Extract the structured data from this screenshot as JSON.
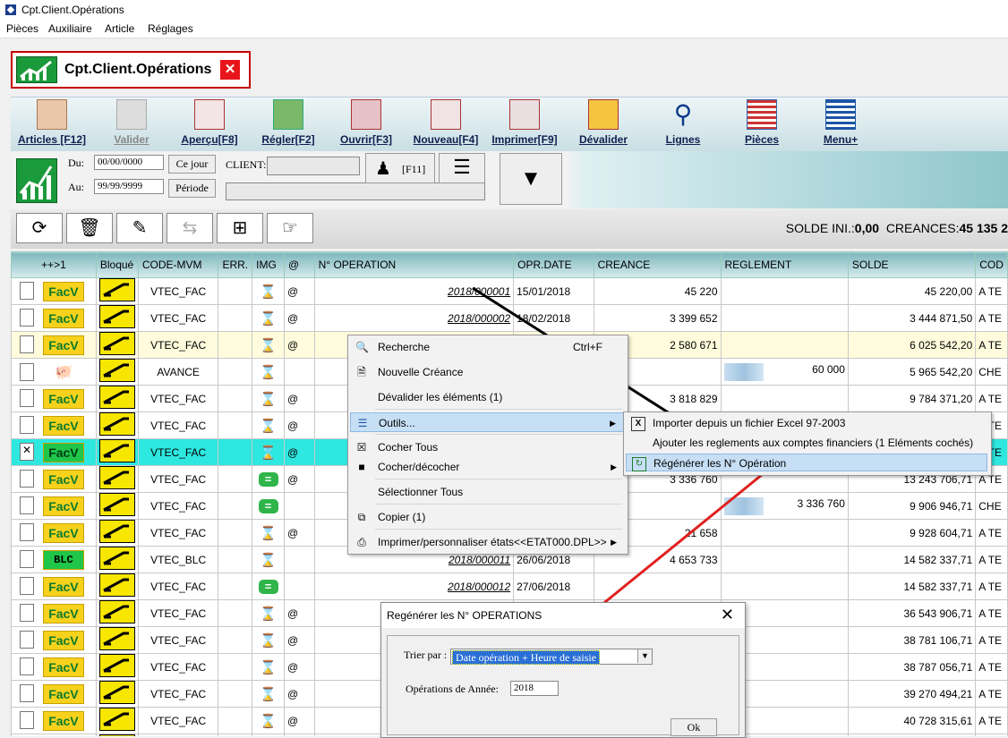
{
  "window": {
    "title": "Cpt.Client.Opérations"
  },
  "menubar": [
    "Pièces",
    "Auxiliaire",
    "Article",
    "Réglages"
  ],
  "doc_tab": {
    "title": "Cpt.Client.Opérations",
    "close": "✕"
  },
  "toolbar": [
    {
      "label": "Articles [F12]",
      "icon": "articles-icon",
      "enabled": true
    },
    {
      "label": "Valider",
      "icon": "validate-icon",
      "enabled": false
    },
    {
      "label": "Aperçu[F8]",
      "icon": "preview-icon",
      "enabled": true
    },
    {
      "label": "Régler[F2]",
      "icon": "money-icon",
      "enabled": true
    },
    {
      "label": "Ouvrir[F3]",
      "icon": "open-icon",
      "enabled": true
    },
    {
      "label": "Nouveau[F4]",
      "icon": "new-icon",
      "enabled": true
    },
    {
      "label": "Imprimer[F9]",
      "icon": "print-icon",
      "enabled": true
    },
    {
      "label": "Dévalider",
      "icon": "unvalidate-icon",
      "enabled": true
    },
    {
      "label": "Lignes",
      "icon": "search-icon",
      "enabled": true
    },
    {
      "label": "Pièces",
      "icon": "pieces-icon",
      "enabled": true
    },
    {
      "label": "Menu+",
      "icon": "menu-icon",
      "enabled": true
    }
  ],
  "filter": {
    "du_label": "Du:",
    "du_value": "00/00/0000",
    "au_label": "Au:",
    "au_value": "99/99/9999",
    "ce_jour": "Ce jour",
    "periode": "Période",
    "client_label": "CLIENT:",
    "client_value": "",
    "f11_label": "[F11]"
  },
  "solde": {
    "solde_ini_label": "SOLDE INI.:",
    "solde_ini_value": "0,00",
    "creances_label": "CREANCES:",
    "creances_value": "45 135 2"
  },
  "grid": {
    "columns": [
      "++>1",
      "Bloqué",
      "CODE-MVM",
      "ERR.",
      "IMG",
      "@",
      "N° OPERATION",
      "OPR.DATE",
      "CREANCE",
      "REGLEMENT",
      "SOLDE",
      "COD"
    ],
    "rows": [
      {
        "tag": "FacV",
        "code": "VTEC_FAC",
        "img": "hourglass",
        "at": "@",
        "num": "2018/000001",
        "date": "15/01/2018",
        "creance": "45 220",
        "reglement": "",
        "solde": "45 220,00",
        "cod": "A TE"
      },
      {
        "tag": "FacV",
        "code": "VTEC_FAC",
        "img": "hourglass",
        "at": "@",
        "num": "2018/000002",
        "date": "18/02/2018",
        "creance": "3 399 652",
        "reglement": "",
        "solde": "3 444 871,50",
        "cod": "A TE"
      },
      {
        "tag": "FacV",
        "code": "VTEC_FAC",
        "img": "hourglass",
        "at": "@",
        "num": "",
        "date": "",
        "creance": "2 580 671",
        "reglement": "",
        "solde": "6 025 542,20",
        "cod": "A TE",
        "selected": true
      },
      {
        "tag": "pig",
        "code": "AVANCE",
        "img": "hourglass",
        "at": "",
        "num": "",
        "date": "",
        "creance": "",
        "reglement": "60 000",
        "solde": "5 965 542,20",
        "cod": "CHE",
        "map": true
      },
      {
        "tag": "FacV",
        "code": "VTEC_FAC",
        "img": "hourglass",
        "at": "@",
        "num": "",
        "date": "",
        "creance": "3 818 829",
        "reglement": "",
        "solde": "9 784 371,20",
        "cod": "A TE"
      },
      {
        "tag": "FacV",
        "code": "VTEC_FAC",
        "img": "hourglass",
        "at": "@",
        "num": "",
        "date": "",
        "creance": "",
        "reglement": "",
        "solde": "",
        "cod": "A TE"
      },
      {
        "tag": "FacV",
        "code": "VTEC_FAC",
        "img": "hourglass",
        "at": "@",
        "num": "",
        "date": "",
        "creance": "",
        "reglement": "",
        "solde": "",
        "cod": "A TE",
        "highlight": true,
        "checked": true
      },
      {
        "tag": "FacV",
        "code": "VTEC_FAC",
        "img": "equals",
        "at": "@",
        "num": "",
        "date": "",
        "creance": "3 336 760",
        "reglement": "",
        "solde": "13 243 706,71",
        "cod": "A TE"
      },
      {
        "tag": "FacV",
        "code": "VTEC_FAC",
        "img": "equals",
        "at": "",
        "num": "",
        "date": "",
        "creance": "",
        "reglement": "3 336 760",
        "solde": "9 906 946,71",
        "cod": "CHE",
        "map": true
      },
      {
        "tag": "FacV",
        "code": "VTEC_FAC",
        "img": "hourglass",
        "at": "@",
        "num": "",
        "date": "",
        "creance": "21 658",
        "reglement": "",
        "solde": "9 928 604,71",
        "cod": "A TE"
      },
      {
        "tag": "BLC",
        "code": "VTEC_BLC",
        "img": "hourglass",
        "at": "",
        "num": "2018/000011",
        "date": "26/06/2018",
        "creance": "4 653 733",
        "reglement": "",
        "solde": "14 582 337,71",
        "cod": "A TE"
      },
      {
        "tag": "FacV",
        "code": "VTEC_FAC",
        "img": "equals",
        "at": "",
        "num": "2018/000012",
        "date": "27/06/2018",
        "creance": "",
        "reglement": "",
        "solde": "14 582 337,71",
        "cod": "A TE"
      },
      {
        "tag": "FacV",
        "code": "VTEC_FAC",
        "img": "hourglass",
        "at": "@",
        "num": "",
        "date": "",
        "creance": "",
        "reglement": "",
        "solde": "36 543 906,71",
        "cod": "A TE"
      },
      {
        "tag": "FacV",
        "code": "VTEC_FAC",
        "img": "hourglass",
        "at": "@",
        "num": "",
        "date": "",
        "creance": "",
        "reglement": "",
        "solde": "38 781 106,71",
        "cod": "A TE"
      },
      {
        "tag": "FacV",
        "code": "VTEC_FAC",
        "img": "hourglass",
        "at": "@",
        "num": "",
        "date": "",
        "creance": "",
        "reglement": "",
        "solde": "38 787 056,71",
        "cod": "A TE"
      },
      {
        "tag": "FacV",
        "code": "VTEC_FAC",
        "img": "hourglass",
        "at": "@",
        "num": "",
        "date": "",
        "creance": "",
        "reglement": "",
        "solde": "39 270 494,21",
        "cod": "A TE"
      },
      {
        "tag": "FacV",
        "code": "VTEC_FAC",
        "img": "hourglass",
        "at": "@",
        "num": "",
        "date": "",
        "creance": "",
        "reglement": "",
        "solde": "40 728 315,61",
        "cod": "A TE"
      },
      {
        "tag": "FacV",
        "code": "",
        "img": "",
        "at": "",
        "num": "",
        "date": "",
        "creance": "",
        "reglement": "",
        "solde": "",
        "cod": ""
      }
    ]
  },
  "context_menu": {
    "items": [
      {
        "label": "Recherche",
        "shortcut": "Ctrl+F",
        "icon": "binoculars-icon"
      },
      {
        "label": "Nouvelle Créance",
        "icon": "new-document-icon"
      },
      {
        "label": "Dévalider les éléments (1)",
        "icon": ""
      },
      {
        "label": "Outils...",
        "icon": "tools-icon",
        "submenu": true,
        "active": true
      },
      {
        "label": "Cocher Tous",
        "icon": "checkbox-checked-icon"
      },
      {
        "label": "Cocher/décocher",
        "icon": "checkbox-toggle-icon",
        "submenu": true
      },
      {
        "label": "Sélectionner Tous",
        "icon": ""
      },
      {
        "label": "Copier (1)",
        "icon": "copy-icon"
      },
      {
        "label": "Imprimer/personnaliser états<<ETAT000.DPL>>",
        "icon": "printer-icon",
        "submenu": true
      }
    ]
  },
  "submenu": {
    "items": [
      {
        "label": "Importer depuis un fichier Excel 97-2003",
        "icon": "excel-import-icon"
      },
      {
        "label": "Ajouter les reglements aux comptes financiers (1 Eléments cochés)",
        "icon": ""
      },
      {
        "label": "Régénérer les N° Opération",
        "icon": "regenerate-icon",
        "active": true
      }
    ]
  },
  "dialog": {
    "title": "Regénérer les N° OPERATIONS",
    "close": "✕",
    "trier_label": "Trier par :",
    "trier_value": "Date opération + Heure de saisie",
    "annee_label": "Opérations de Année:",
    "annee_value": "2018",
    "ok_label": "Ok"
  }
}
